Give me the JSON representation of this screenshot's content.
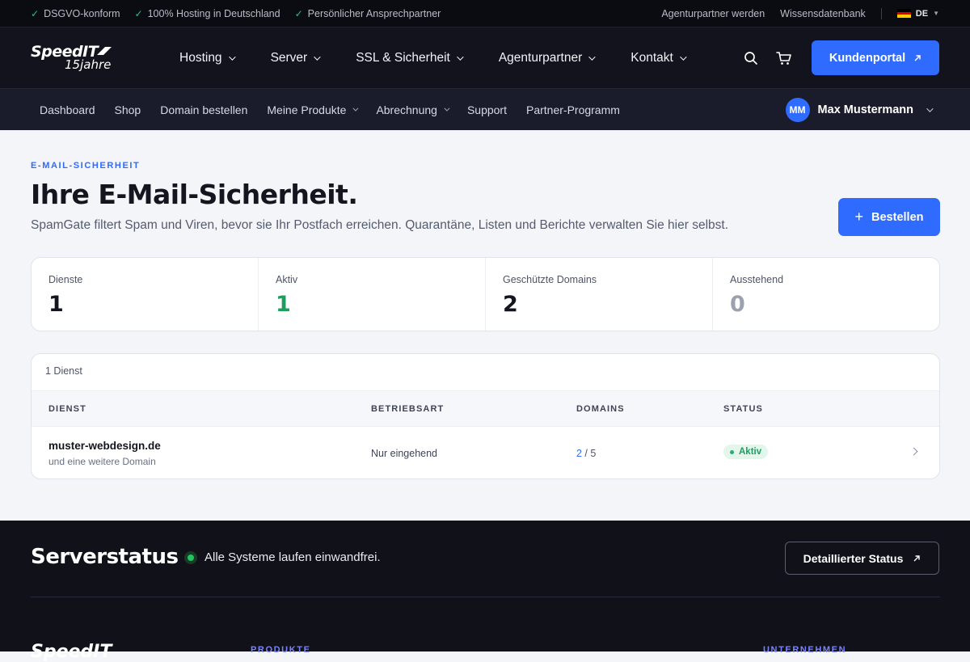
{
  "topbar": {
    "trust": [
      "DSGVO-konform",
      "100% Hosting in Deutschland",
      "Persönlicher Ansprechpartner"
    ],
    "check_icon": "✓",
    "links": [
      "Agenturpartner werden",
      "Wissensdatenbank"
    ],
    "language": "DE"
  },
  "nav": {
    "logo_brand": "SpeedIT",
    "logo_years": "15jahre",
    "items": [
      "Hosting",
      "Server",
      "SSL & Sicherheit",
      "Agenturpartner",
      "Kontakt"
    ],
    "icons": [
      "search-icon",
      "cart-icon"
    ],
    "portal_label": "Kundenportal",
    "accent": "#2f6bff"
  },
  "subnav": {
    "items": [
      "Dashboard",
      "Shop",
      "Domain bestellen",
      "Meine Produkte",
      "Abrechnung",
      "Support",
      "Partner-Programm"
    ],
    "user_initials": "MM",
    "user_name": "Max Mustermann"
  },
  "page": {
    "eyebrow": "E-MAIL-SICHERHEIT",
    "title": "Ihre E-Mail-Sicherheit.",
    "subtitle": "SpamGate filtert Spam und Viren, bevor sie Ihr Postfach erreichen. Quarantäne, Listen und Berichte verwalten Sie hier selbst.",
    "order_label": "Bestellen"
  },
  "stats": [
    {
      "label": "Dienste",
      "value": "1",
      "color": "#14161f"
    },
    {
      "label": "Aktiv",
      "value": "1",
      "color": "#1f9d5f"
    },
    {
      "label": "Geschützte Domains",
      "value": "2",
      "color": "#14161f"
    },
    {
      "label": "Ausstehend",
      "value": "0",
      "color": "#9ca1b0"
    }
  ],
  "table": {
    "count": "1 Dienst",
    "headers": [
      "DIENST",
      "BETRIEBSART",
      "DOMAINS",
      "STATUS"
    ],
    "row": {
      "service": "muster-webdesign.de",
      "service_sub": "und eine weitere Domain",
      "mode": "Nur eingehend",
      "domains_used": "2",
      "domains_total": " / 5",
      "status": "Aktiv",
      "status_color": "#1f9d5f"
    }
  },
  "footer": {
    "title": "Serverstatus",
    "status_text": "Alle Systeme laufen einwandfrei.",
    "status_button": "Detaillierter Status",
    "logo": "SpeedIT",
    "columns": [
      "PRODUKTE",
      "UNTERNEHMEN"
    ]
  }
}
